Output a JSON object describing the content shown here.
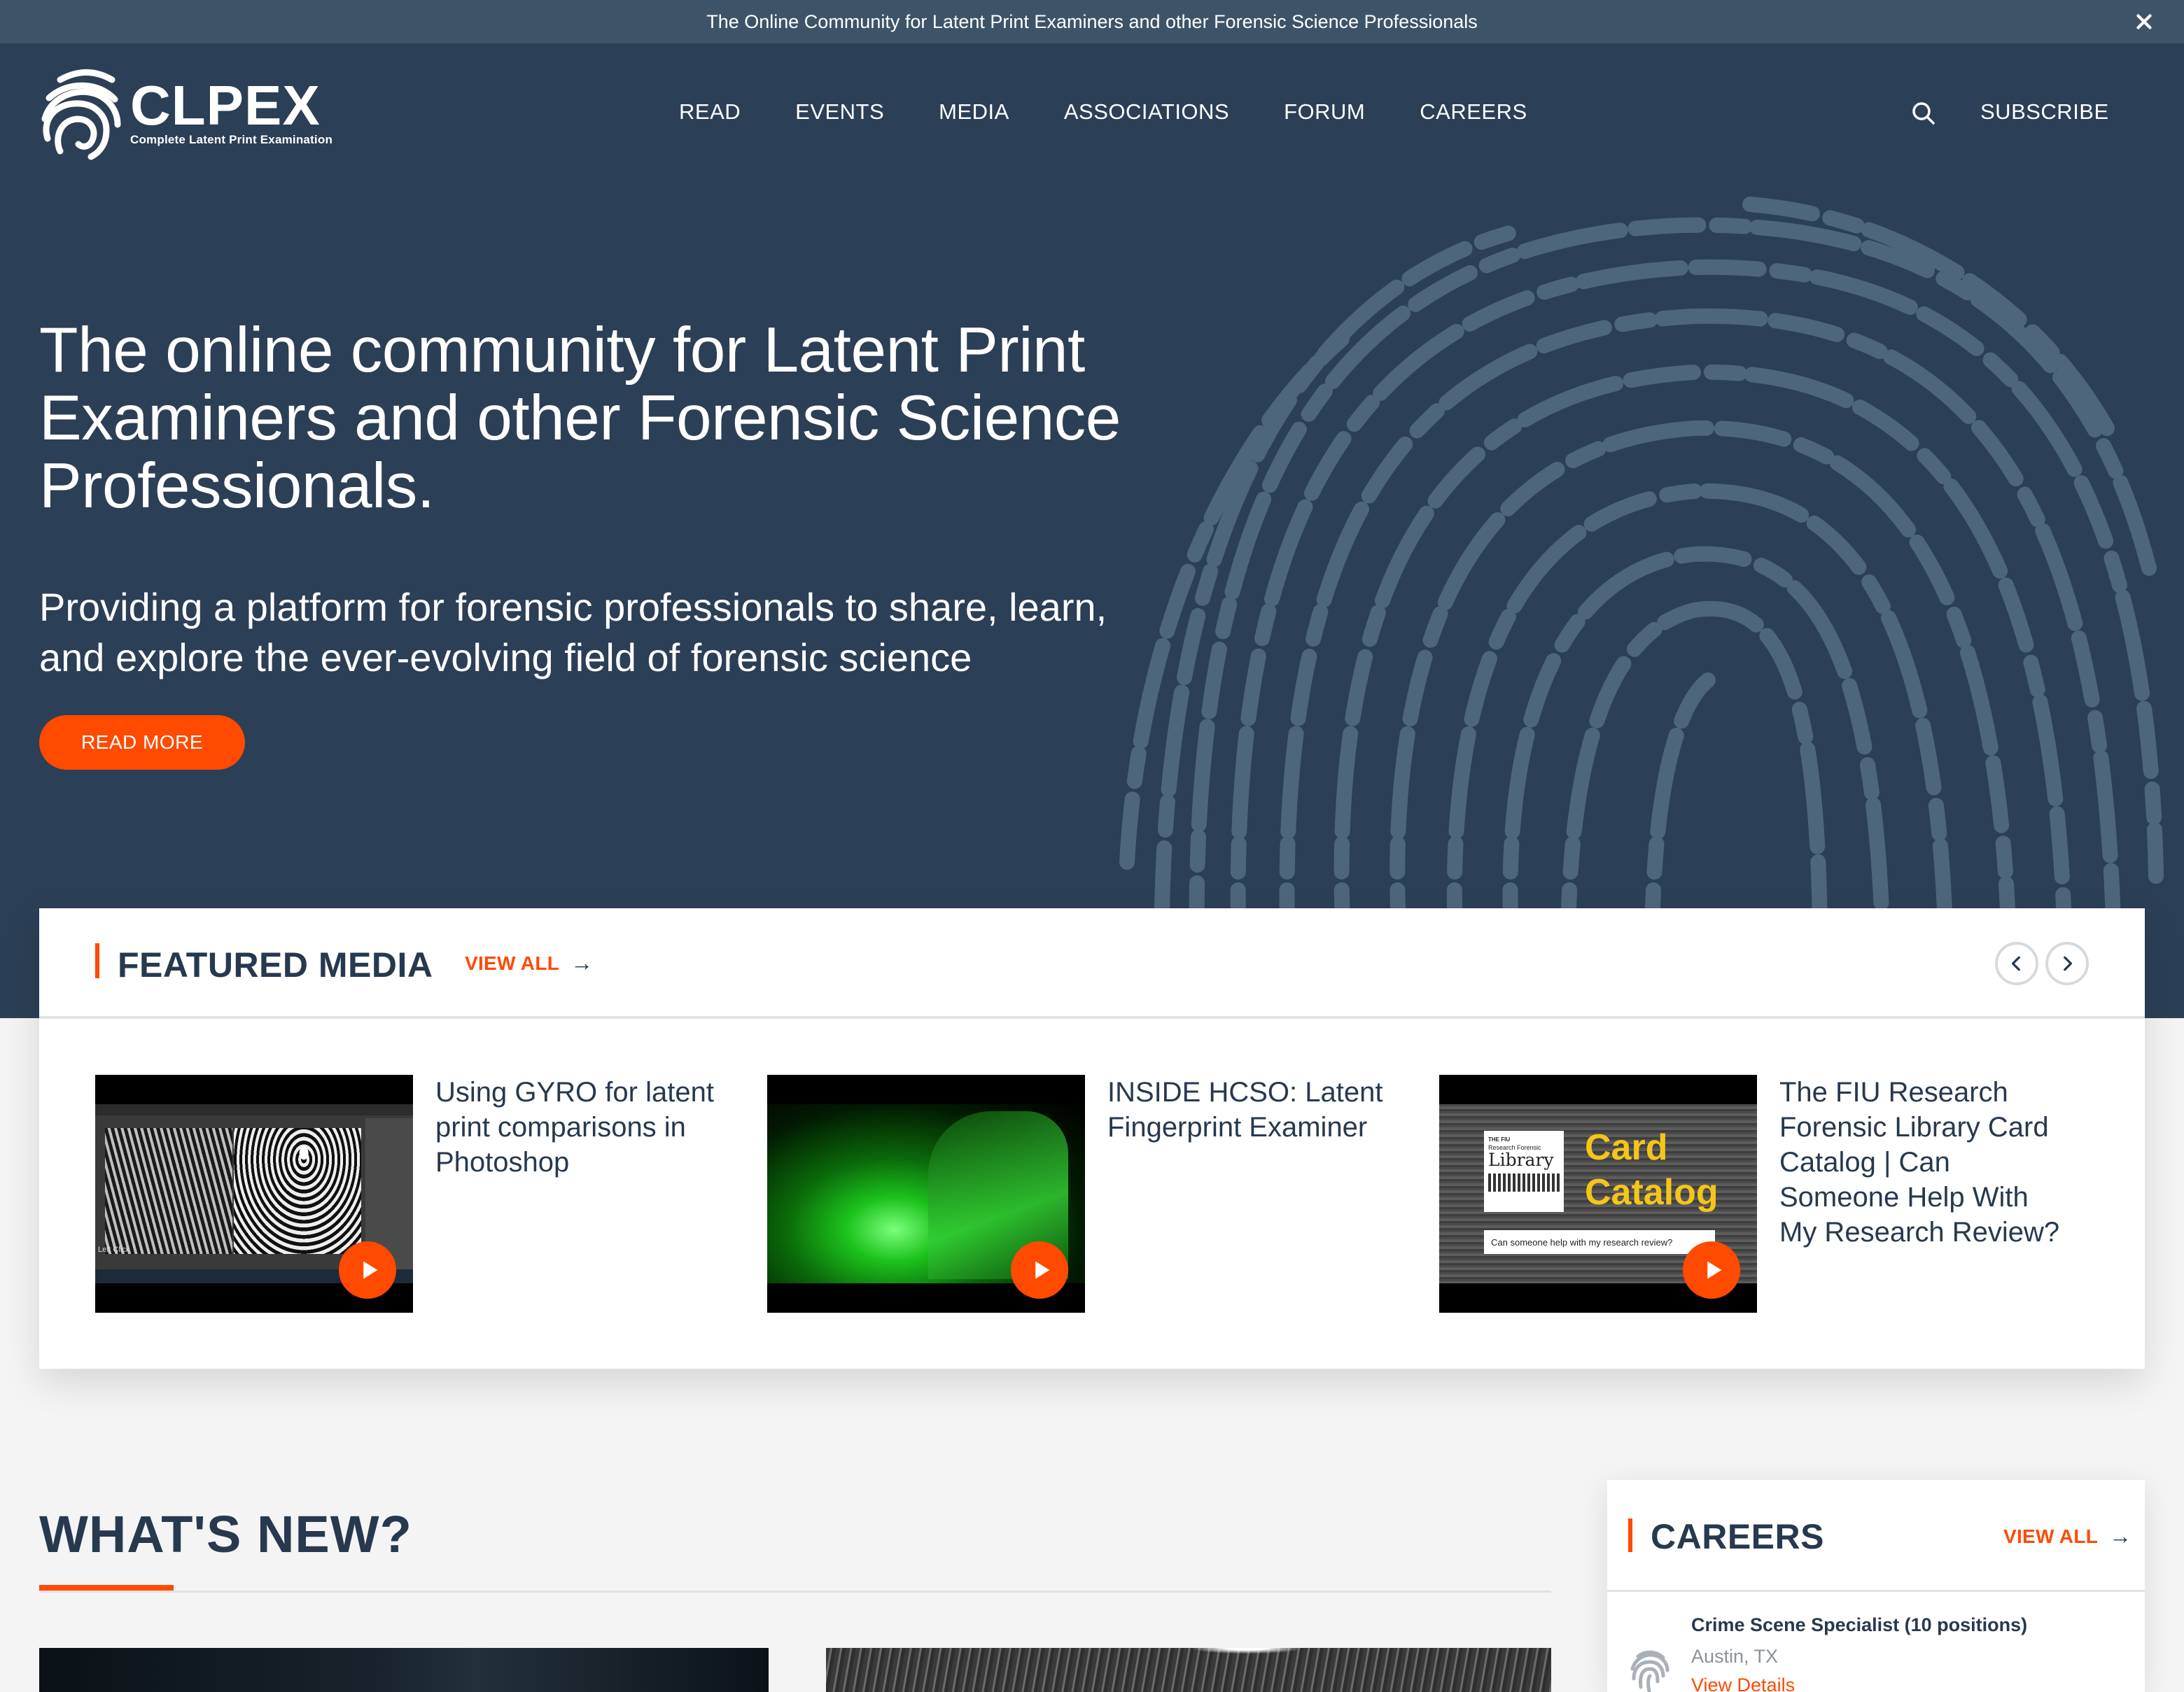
{
  "announcement": {
    "text": "The Online Community for Latent Print Examiners and other Forensic Science Professionals",
    "close_icon": "close-icon"
  },
  "brand": {
    "name": "CLPEX",
    "tagline": "Complete Latent Print Examination",
    "logo_icon": "fingerprint-icon"
  },
  "nav": {
    "items": [
      {
        "label": "READ"
      },
      {
        "label": "EVENTS"
      },
      {
        "label": "MEDIA"
      },
      {
        "label": "ASSOCIATIONS"
      },
      {
        "label": "FORUM"
      },
      {
        "label": "CAREERS"
      }
    ],
    "search_icon": "search-icon",
    "subscribe_label": "SUBSCRIBE"
  },
  "hero": {
    "title": "The online community for Latent Print Examiners and other Forensic Science Professionals.",
    "subtitle": "Providing a platform for forensic professionals to share, learn, and explore the ever-evolving field of forensic science",
    "cta_label": "READ MORE",
    "background_icon": "fingerprint-background"
  },
  "featured_media": {
    "title": "FEATURED MEDIA",
    "view_all_label": "VIEW ALL",
    "arrow": "→",
    "items": [
      {
        "title": "Using GYRO for latent print comparisons in Photoshop",
        "thumb_caption": "Left Click",
        "play_icon": "play-icon"
      },
      {
        "title": "INSIDE HCSO: Latent Fingerprint Examiner",
        "play_icon": "play-icon"
      },
      {
        "title": "The FIU Research Forensic Library Card Catalog | Can Someone Help With My Research Review?",
        "thumb_lib_line1": "THE FIU",
        "thumb_lib_line2": "Research Forensic",
        "thumb_lib_line3": "Library",
        "thumb_heading": "Card Catalog",
        "thumb_search": "Can someone help with my research review?",
        "play_icon": "play-icon"
      }
    ]
  },
  "whats_new": {
    "title": "WHAT'S NEW?"
  },
  "careers": {
    "title": "CAREERS",
    "view_all_label": "VIEW ALL",
    "arrow": "→",
    "jobs": [
      {
        "title": "Crime Scene Specialist (10 positions)",
        "location": "Austin, TX",
        "link_label": "View Details"
      }
    ]
  },
  "colors": {
    "primary_navy": "#2b3f56",
    "topbar": "#3d5468",
    "accent_orange": "#ff4a00",
    "text_dark": "#27394f",
    "page_bg": "#f4f4f4"
  }
}
